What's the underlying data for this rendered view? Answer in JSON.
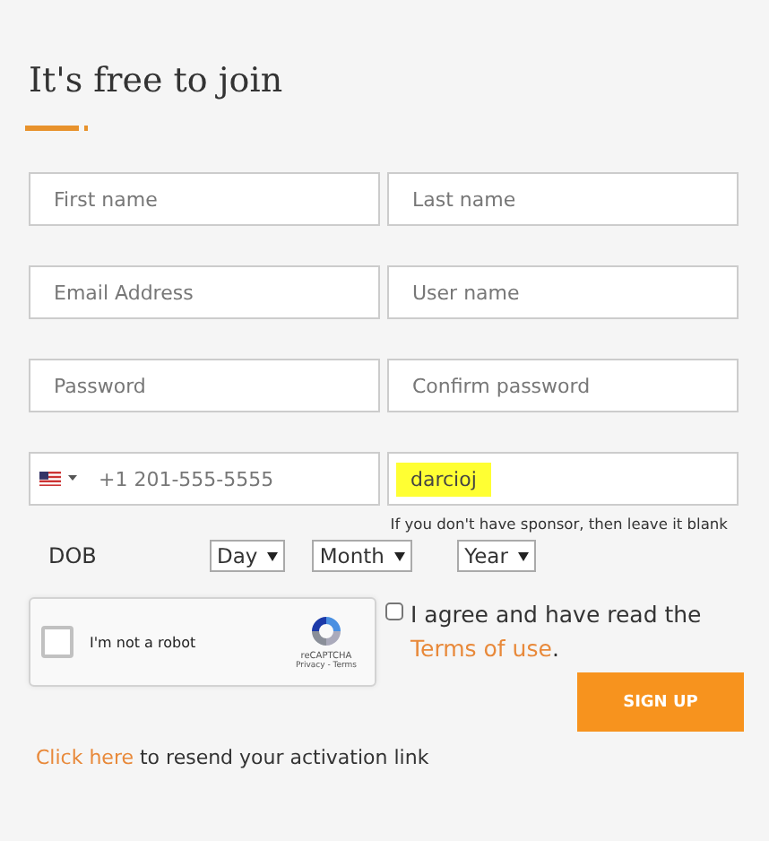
{
  "title": "It's free to join",
  "field_rows": [
    [
      {
        "placeholder": "First name"
      },
      {
        "placeholder": "Last name"
      }
    ],
    [
      {
        "placeholder": "Email Address"
      },
      {
        "placeholder": "User name"
      }
    ],
    [
      {
        "placeholder": "Password"
      },
      {
        "placeholder": "Confirm password"
      }
    ]
  ],
  "phone": {
    "placeholder": "+1 201-555-5555"
  },
  "sponsor": {
    "value": "darcioj",
    "highlighted": true,
    "hint": "If you don't have sponsor, then leave it blank"
  },
  "dob": {
    "label": "DOB",
    "selects": [
      "Day",
      "Month",
      "Year"
    ]
  },
  "captcha": {
    "label": "I'm not a robot",
    "brand": "reCAPTCHA",
    "links": "Privacy - Terms",
    "checked": false
  },
  "agree": {
    "checked": false,
    "text": "I agree and have read the",
    "link": "Terms of use",
    "end": "."
  },
  "submit": "SIGN UP",
  "resend": {
    "link": "Click here",
    "text": "to resend your activation link"
  }
}
